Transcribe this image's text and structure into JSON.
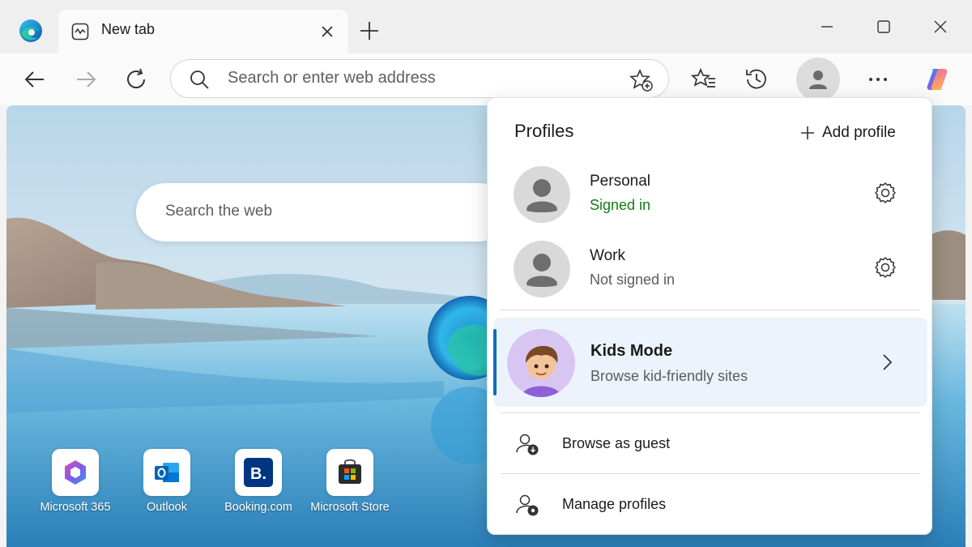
{
  "window": {
    "tab_title": "New tab",
    "icons": [
      "edge-logo-icon",
      "newtab-page-icon",
      "close-icon",
      "plus-icon",
      "minimize-icon",
      "maximize-icon",
      "close-window-icon"
    ]
  },
  "toolbar": {
    "address_placeholder": "Search or enter web address",
    "icons": [
      "back-icon",
      "forward-icon",
      "refresh-icon",
      "search-icon",
      "add-favorite-icon",
      "favorites-icon",
      "history-icon",
      "profile-icon",
      "more-icon",
      "copilot-icon"
    ]
  },
  "page": {
    "search_placeholder": "Search the web",
    "quick_links": [
      {
        "label": "Microsoft 365",
        "icon": "microsoft365-icon"
      },
      {
        "label": "Outlook",
        "icon": "outlook-icon"
      },
      {
        "label": "Booking.com",
        "icon": "booking-icon"
      },
      {
        "label": "Microsoft Store",
        "icon": "store-icon"
      }
    ]
  },
  "profiles_menu": {
    "title": "Profiles",
    "add_profile": "Add profile",
    "profiles": [
      {
        "name": "Personal",
        "status": "Signed in",
        "status_color": "#107c10"
      },
      {
        "name": "Work",
        "status": "Not signed in",
        "status_color": "#5c5c5c"
      }
    ],
    "kids_mode": {
      "title": "Kids Mode",
      "subtitle": "Browse kid-friendly sites"
    },
    "actions": [
      {
        "label": "Browse as guest",
        "icon": "guest-icon"
      },
      {
        "label": "Manage profiles",
        "icon": "manage-profiles-icon"
      }
    ]
  },
  "colors": {
    "accent": "#0f6cbd",
    "signed_in": "#107c10"
  }
}
